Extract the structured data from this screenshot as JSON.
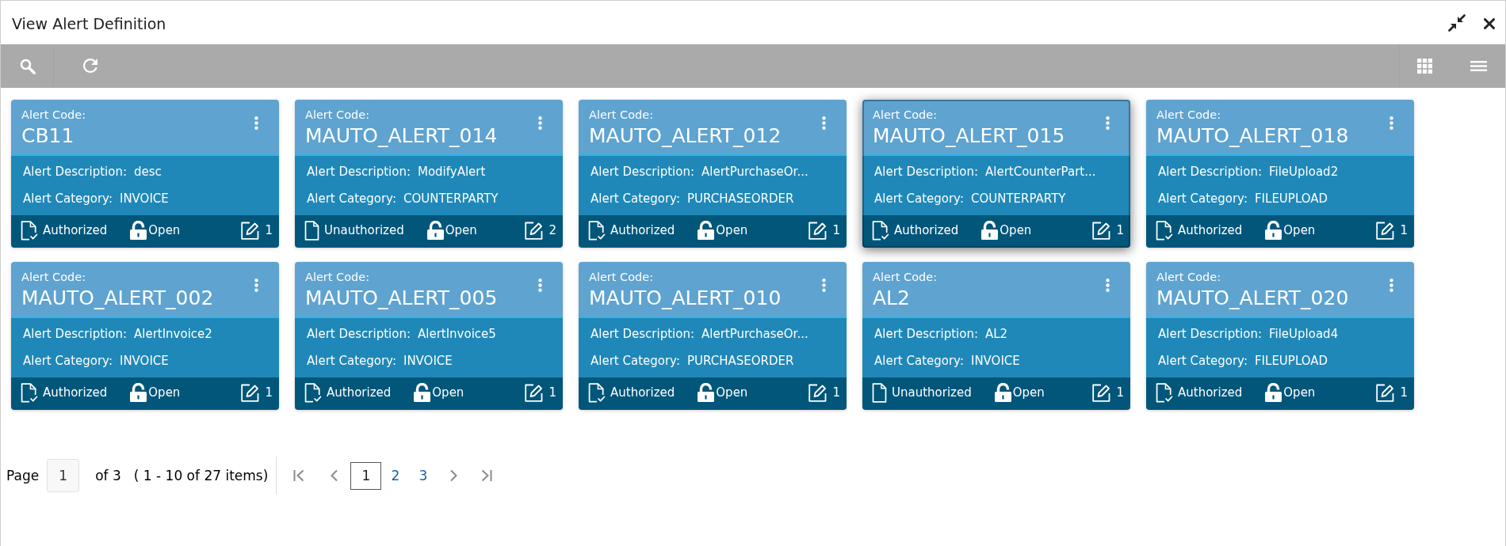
{
  "window": {
    "title": "View Alert Definition"
  },
  "cards": [
    {
      "code_label": "Alert Code:",
      "code": "CB11",
      "fields": [
        {
          "label": "Alert Description:",
          "value": "desc"
        },
        {
          "label": "Alert Category:",
          "value": "INVOICE"
        }
      ],
      "status": {
        "kind": "authorized",
        "label": "Authorized"
      },
      "lock": {
        "kind": "open",
        "label": "Open"
      },
      "edits": "1",
      "selected": false
    },
    {
      "code_label": "Alert Code:",
      "code": "MAUTO_ALERT_014",
      "fields": [
        {
          "label": "Alert Description:",
          "value": "ModifyAlert"
        },
        {
          "label": "Alert Category:",
          "value": "COUNTERPARTY"
        }
      ],
      "status": {
        "kind": "unauthorized",
        "label": "Unauthorized"
      },
      "lock": {
        "kind": "open",
        "label": "Open"
      },
      "edits": "2",
      "selected": false
    },
    {
      "code_label": "Alert Code:",
      "code": "MAUTO_ALERT_012",
      "fields": [
        {
          "label": "Alert Description:",
          "value": "AlertPurchaseOr..."
        },
        {
          "label": "Alert Category:",
          "value": "PURCHASEORDER"
        }
      ],
      "status": {
        "kind": "authorized",
        "label": "Authorized"
      },
      "lock": {
        "kind": "open",
        "label": "Open"
      },
      "edits": "1",
      "selected": false
    },
    {
      "code_label": "Alert Code:",
      "code": "MAUTO_ALERT_015",
      "fields": [
        {
          "label": "Alert Description:",
          "value": "AlertCounterPart..."
        },
        {
          "label": "Alert Category:",
          "value": "COUNTERPARTY"
        }
      ],
      "status": {
        "kind": "authorized",
        "label": "Authorized"
      },
      "lock": {
        "kind": "open",
        "label": "Open"
      },
      "edits": "1",
      "selected": true
    },
    {
      "code_label": "Alert Code:",
      "code": "MAUTO_ALERT_018",
      "fields": [
        {
          "label": "Alert Description:",
          "value": "FileUpload2"
        },
        {
          "label": "Alert Category:",
          "value": "FILEUPLOAD"
        }
      ],
      "status": {
        "kind": "authorized",
        "label": "Authorized"
      },
      "lock": {
        "kind": "open",
        "label": "Open"
      },
      "edits": "1",
      "selected": false
    },
    {
      "code_label": "Alert Code:",
      "code": "MAUTO_ALERT_002",
      "fields": [
        {
          "label": "Alert Description:",
          "value": "AlertInvoice2"
        },
        {
          "label": "Alert Category:",
          "value": "INVOICE"
        }
      ],
      "status": {
        "kind": "authorized",
        "label": "Authorized"
      },
      "lock": {
        "kind": "open",
        "label": "Open"
      },
      "edits": "1",
      "selected": false
    },
    {
      "code_label": "Alert Code:",
      "code": "MAUTO_ALERT_005",
      "fields": [
        {
          "label": "Alert Description:",
          "value": "AlertInvoice5"
        },
        {
          "label": "Alert Category:",
          "value": "INVOICE"
        }
      ],
      "status": {
        "kind": "authorized",
        "label": "Authorized"
      },
      "lock": {
        "kind": "open",
        "label": "Open"
      },
      "edits": "1",
      "selected": false
    },
    {
      "code_label": "Alert Code:",
      "code": "MAUTO_ALERT_010",
      "fields": [
        {
          "label": "Alert Description:",
          "value": "AlertPurchaseOr..."
        },
        {
          "label": "Alert Category:",
          "value": "PURCHASEORDER"
        }
      ],
      "status": {
        "kind": "authorized",
        "label": "Authorized"
      },
      "lock": {
        "kind": "open",
        "label": "Open"
      },
      "edits": "1",
      "selected": false
    },
    {
      "code_label": "Alert Code:",
      "code": "AL2",
      "fields": [
        {
          "label": "Alert Description:",
          "value": "AL2"
        },
        {
          "label": "Alert Category:",
          "value": "INVOICE"
        }
      ],
      "status": {
        "kind": "unauthorized",
        "label": "Unauthorized"
      },
      "lock": {
        "kind": "open",
        "label": "Open"
      },
      "edits": "1",
      "selected": false
    },
    {
      "code_label": "Alert Code:",
      "code": "MAUTO_ALERT_020",
      "fields": [
        {
          "label": "Alert Description:",
          "value": "FileUpload4"
        },
        {
          "label": "Alert Category:",
          "value": "FILEUPLOAD"
        }
      ],
      "status": {
        "kind": "authorized",
        "label": "Authorized"
      },
      "lock": {
        "kind": "open",
        "label": "Open"
      },
      "edits": "1",
      "selected": false
    }
  ],
  "pagination": {
    "label": "Page",
    "value": "1",
    "of": "of 3",
    "summary": "( 1 - 10 of 27 items)",
    "pages": [
      {
        "label": "1",
        "selected": true
      },
      {
        "label": "2",
        "selected": false
      },
      {
        "label": "3",
        "selected": false
      }
    ]
  }
}
